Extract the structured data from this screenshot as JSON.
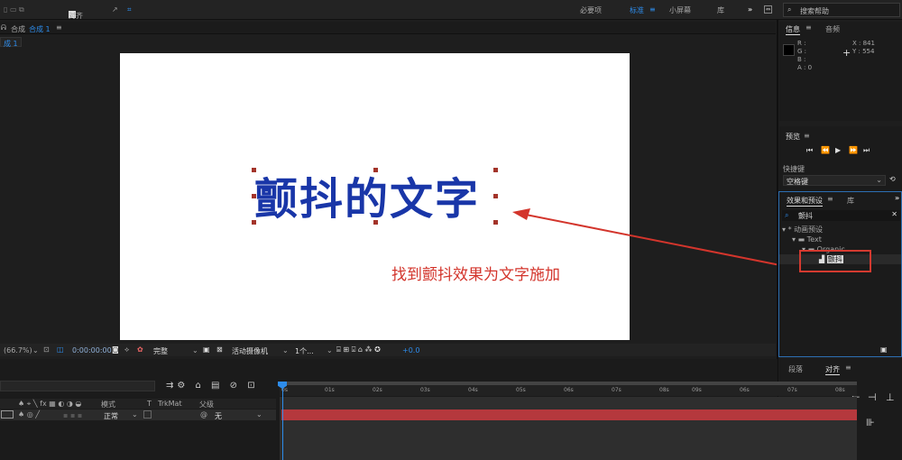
{
  "topbar": {
    "align_label": "对齐",
    "workspaces": [
      "必要项",
      "标准",
      "小屏幕",
      "库"
    ],
    "active_workspace": "标准",
    "search_placeholder": "搜索帮助",
    "overflow": "»"
  },
  "comp_panel": {
    "tab_prefix": "合成",
    "tab_label": "合成 1",
    "breadcrumb": "成 1"
  },
  "canvas": {
    "text": "颤抖的文字",
    "text_color": "#1936a8",
    "annotation": "找到颤抖效果为文字施加",
    "annotation_color": "#d3352c"
  },
  "viewer_bar": {
    "zoom": "(66.7%)",
    "timecode": "0:00:00:00",
    "resolution": "完整",
    "camera": "活动摄像机",
    "views": "1个...",
    "exposure": "+0.0"
  },
  "info_panel": {
    "tabs": [
      "信息",
      "音频"
    ],
    "r": "R :",
    "g": "G :",
    "b": "B :",
    "a": "A : 0",
    "x": "X : 841",
    "y": "Y : 554"
  },
  "preview_panel": {
    "title": "预览",
    "shortcut_label": "快捷键",
    "shortcut_value": "空格键"
  },
  "effects_panel": {
    "tabs": [
      "效果和预设",
      "库"
    ],
    "search_value": "颤抖",
    "tree": [
      "* 动画预设",
      "Text",
      "Organic",
      "颤抖"
    ]
  },
  "bottom_right": {
    "tabs": [
      "段落",
      "对齐"
    ]
  },
  "timeline": {
    "columns": [
      "模式",
      "T",
      "TrkMat",
      "父级"
    ],
    "mode_value": "正常",
    "parent_value": "无",
    "ticks": [
      "0s",
      "01s",
      "02s",
      "03s",
      "04s",
      "05s",
      "06s",
      "07s",
      "08s",
      "09s",
      "06s",
      "07s",
      "08s"
    ]
  },
  "colors": {
    "accent": "#2d8ceb",
    "layer_bar": "#b5383d",
    "highlight_box": "#d43a30"
  }
}
